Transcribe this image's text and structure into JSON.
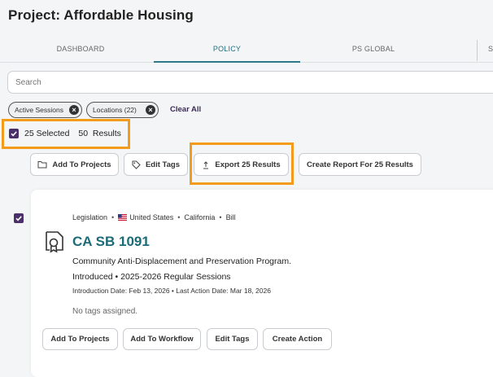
{
  "page": {
    "title": "Project: Affordable Housing"
  },
  "tabs": [
    {
      "label": "DASHBOARD"
    },
    {
      "label": "POLICY"
    },
    {
      "label": "PS GLOBAL"
    },
    {
      "label": "S"
    }
  ],
  "search": {
    "placeholder": "Search"
  },
  "filters": {
    "chips": [
      {
        "label": "Active Sessions"
      },
      {
        "label": "Locations (22)"
      }
    ],
    "clear_label": "Clear All"
  },
  "selection": {
    "selected": "25 Selected",
    "results": "50  Results"
  },
  "toolbar": {
    "add_to_projects": "Add To Projects",
    "edit_tags": "Edit Tags",
    "export": "Export 25 Results",
    "create_report": "Create Report For 25 Results"
  },
  "result": {
    "type": "Legislation",
    "country": "United States",
    "state": "California",
    "kind": "Bill",
    "title": "CA SB 1091",
    "description": "Community Anti-Displacement and Preservation Program.",
    "status_line": "Introduced • 2025-2026 Regular Sessions",
    "dates": "Introduction Date: Feb 13, 2026 • Last Action Date: Mar 18, 2026",
    "tags_text": "No tags assigned.",
    "actions": {
      "add_to_projects": "Add To Projects",
      "add_to_workflow": "Add To Workflow",
      "edit_tags": "Edit Tags",
      "create_action": "Create Action"
    }
  },
  "colors": {
    "accent_teal": "#1c6b78",
    "highlight_orange": "#f39b1a",
    "checkbox_purple": "#4a2f6a"
  }
}
